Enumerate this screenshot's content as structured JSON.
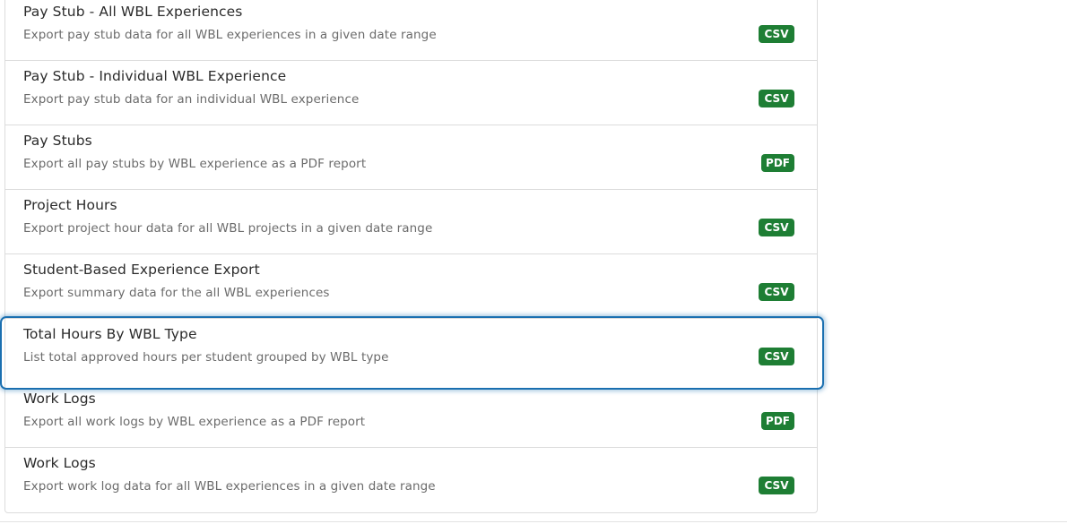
{
  "reports": [
    {
      "title": "Pay Stub - All WBL Experiences",
      "description": "Export pay stub data for all WBL experiences in a given date range",
      "format": "CSV"
    },
    {
      "title": "Pay Stub - Individual WBL Experience",
      "description": "Export pay stub data for an individual WBL experience",
      "format": "CSV"
    },
    {
      "title": "Pay Stubs",
      "description": "Export all pay stubs by WBL experience as a PDF report",
      "format": "PDF"
    },
    {
      "title": "Project Hours",
      "description": "Export project hour data for all WBL projects in a given date range",
      "format": "CSV"
    },
    {
      "title": "Student-Based Experience Export",
      "description": "Export summary data for the all WBL experiences",
      "format": "CSV"
    },
    {
      "title": "Total Hours By WBL Type",
      "description": "List total approved hours per student grouped by WBL type",
      "format": "CSV"
    },
    {
      "title": "Work Logs",
      "description": "Export all work logs by WBL experience as a PDF report",
      "format": "PDF"
    },
    {
      "title": "Work Logs",
      "description": "Export work log data for all WBL experiences in a given date range",
      "format": "CSV"
    }
  ],
  "colors": {
    "badge_bg": "#1e7e34",
    "focus_ring": "#1a6fb0"
  }
}
